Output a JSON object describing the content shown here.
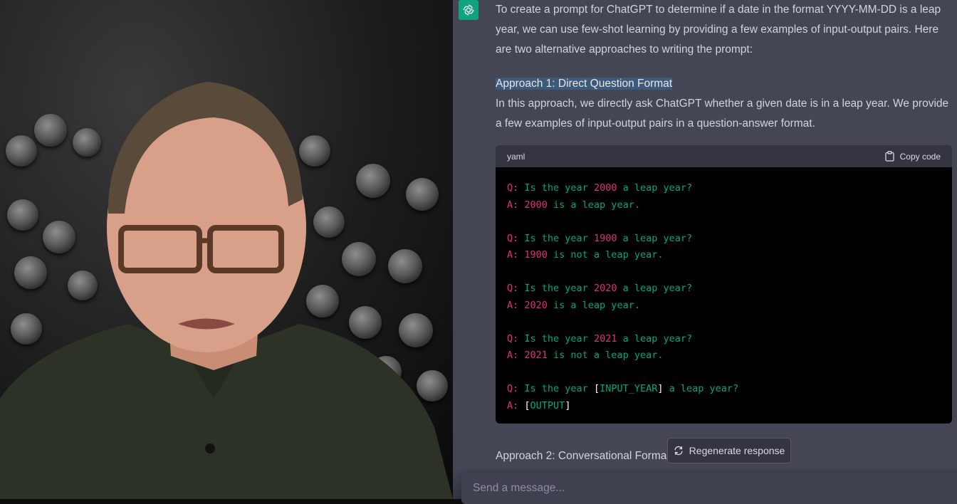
{
  "chat": {
    "intro": "To create a prompt for ChatGPT to determine if a date in the format YYYY-MM-DD is a leap year, we can use few-shot learning by providing a few examples of input-output pairs. Here are two alternative approaches to writing the prompt:",
    "approach1_heading": "Approach 1: Direct Question Format",
    "approach1_body": "In this approach, we directly ask ChatGPT whether a given date is in a leap year. We provide a few examples of input-output pairs in a question-answer format.",
    "approach2_heading": "Approach 2: Conversational Forma",
    "code": {
      "language": "yaml",
      "copy_label": "Copy code",
      "lines": [
        [
          {
            "t": "Q: ",
            "c": "key"
          },
          {
            "t": "Is the year ",
            "c": "text"
          },
          {
            "t": "2000",
            "c": "num"
          },
          {
            "t": " a leap year?",
            "c": "text"
          }
        ],
        [
          {
            "t": "A: ",
            "c": "key"
          },
          {
            "t": "2000",
            "c": "num"
          },
          {
            "t": " is a leap year.",
            "c": "text"
          }
        ],
        [],
        [
          {
            "t": "Q: ",
            "c": "key"
          },
          {
            "t": "Is the year ",
            "c": "text"
          },
          {
            "t": "1900",
            "c": "num"
          },
          {
            "t": " a leap year?",
            "c": "text"
          }
        ],
        [
          {
            "t": "A: ",
            "c": "key"
          },
          {
            "t": "1900",
            "c": "num"
          },
          {
            "t": " is not a leap year.",
            "c": "text"
          }
        ],
        [],
        [
          {
            "t": "Q: ",
            "c": "key"
          },
          {
            "t": "Is the year ",
            "c": "text"
          },
          {
            "t": "2020",
            "c": "num"
          },
          {
            "t": " a leap year?",
            "c": "text"
          }
        ],
        [
          {
            "t": "A: ",
            "c": "key"
          },
          {
            "t": "2020",
            "c": "num"
          },
          {
            "t": " is a leap year.",
            "c": "text"
          }
        ],
        [],
        [
          {
            "t": "Q: ",
            "c": "key"
          },
          {
            "t": "Is the year ",
            "c": "text"
          },
          {
            "t": "2021",
            "c": "num"
          },
          {
            "t": " a leap year?",
            "c": "text"
          }
        ],
        [
          {
            "t": "A: ",
            "c": "key"
          },
          {
            "t": "2021",
            "c": "num"
          },
          {
            "t": " is not a leap year.",
            "c": "text"
          }
        ],
        [],
        [
          {
            "t": "Q: ",
            "c": "key"
          },
          {
            "t": "Is the year ",
            "c": "text"
          },
          {
            "t": "[",
            "c": "brk"
          },
          {
            "t": "INPUT_YEAR",
            "c": "text"
          },
          {
            "t": "]",
            "c": "brk"
          },
          {
            "t": " a leap year?",
            "c": "text"
          }
        ],
        [
          {
            "t": "A: ",
            "c": "key"
          },
          {
            "t": "[",
            "c": "brk"
          },
          {
            "t": "OUTPUT",
            "c": "text"
          },
          {
            "t": "]",
            "c": "brk"
          }
        ]
      ]
    },
    "regenerate_label": "Regenerate response",
    "composer_placeholder": "Send a message..."
  },
  "colors": {
    "chat_bg": "#444654",
    "accent_green": "#10a37f",
    "code_pink": "#df3079",
    "code_green": "#00a67d",
    "selection": "#3d5a7a"
  },
  "icons": {
    "avatar": "openai-logo-icon",
    "copy": "clipboard-icon",
    "regenerate": "refresh-icon"
  }
}
